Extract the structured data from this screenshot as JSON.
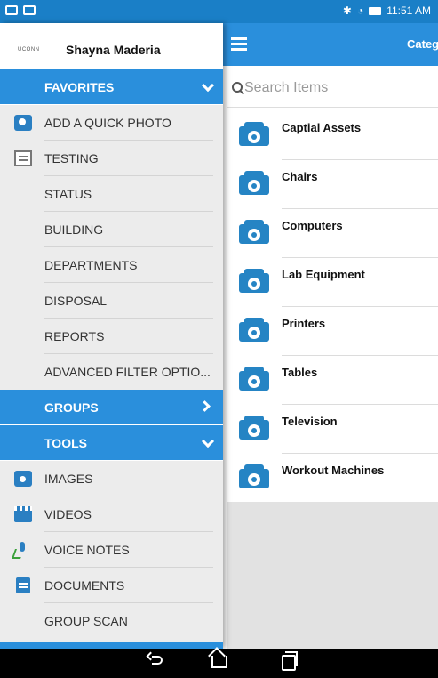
{
  "status_bar": {
    "time": "11:51 AM",
    "icons": [
      "notification-icon",
      "mail-icon",
      "bluetooth-icon",
      "wifi-icon",
      "battery-icon"
    ]
  },
  "drawer": {
    "logo_text": "UCONN",
    "user_name": "Shayna Maderia",
    "sections": {
      "favorites": "FAVORITES",
      "groups": "GROUPS",
      "tools": "TOOLS"
    },
    "favorites_items": [
      {
        "label": "ADD A QUICK PHOTO",
        "icon": "camera-photo-icon"
      },
      {
        "label": "TESTING",
        "icon": "test-report-icon"
      },
      {
        "label": "STATUS"
      },
      {
        "label": "BUILDING"
      },
      {
        "label": "DEPARTMENTS"
      },
      {
        "label": "DISPOSAL"
      },
      {
        "label": "REPORTS"
      },
      {
        "label": "ADVANCED FILTER OPTIO..."
      }
    ],
    "tools_items": [
      {
        "label": "IMAGES",
        "icon": "images-icon"
      },
      {
        "label": "VIDEOS",
        "icon": "video-clapper-icon"
      },
      {
        "label": "VOICE NOTES",
        "icon": "microphone-icon"
      },
      {
        "label": "DOCUMENTS",
        "icon": "document-icon"
      },
      {
        "label": "GROUP SCAN"
      }
    ]
  },
  "app_bar": {
    "title": "Categ"
  },
  "search": {
    "placeholder": "Search Items"
  },
  "categories": [
    "Captial Assets",
    "Chairs",
    "Computers",
    "Lab Equipment",
    "Printers",
    "Tables",
    "Television",
    "Workout Machines"
  ],
  "colors": {
    "accent": "#2a8fdc",
    "status_bar": "#1a7fc7",
    "icon_blue": "#2584c4"
  }
}
